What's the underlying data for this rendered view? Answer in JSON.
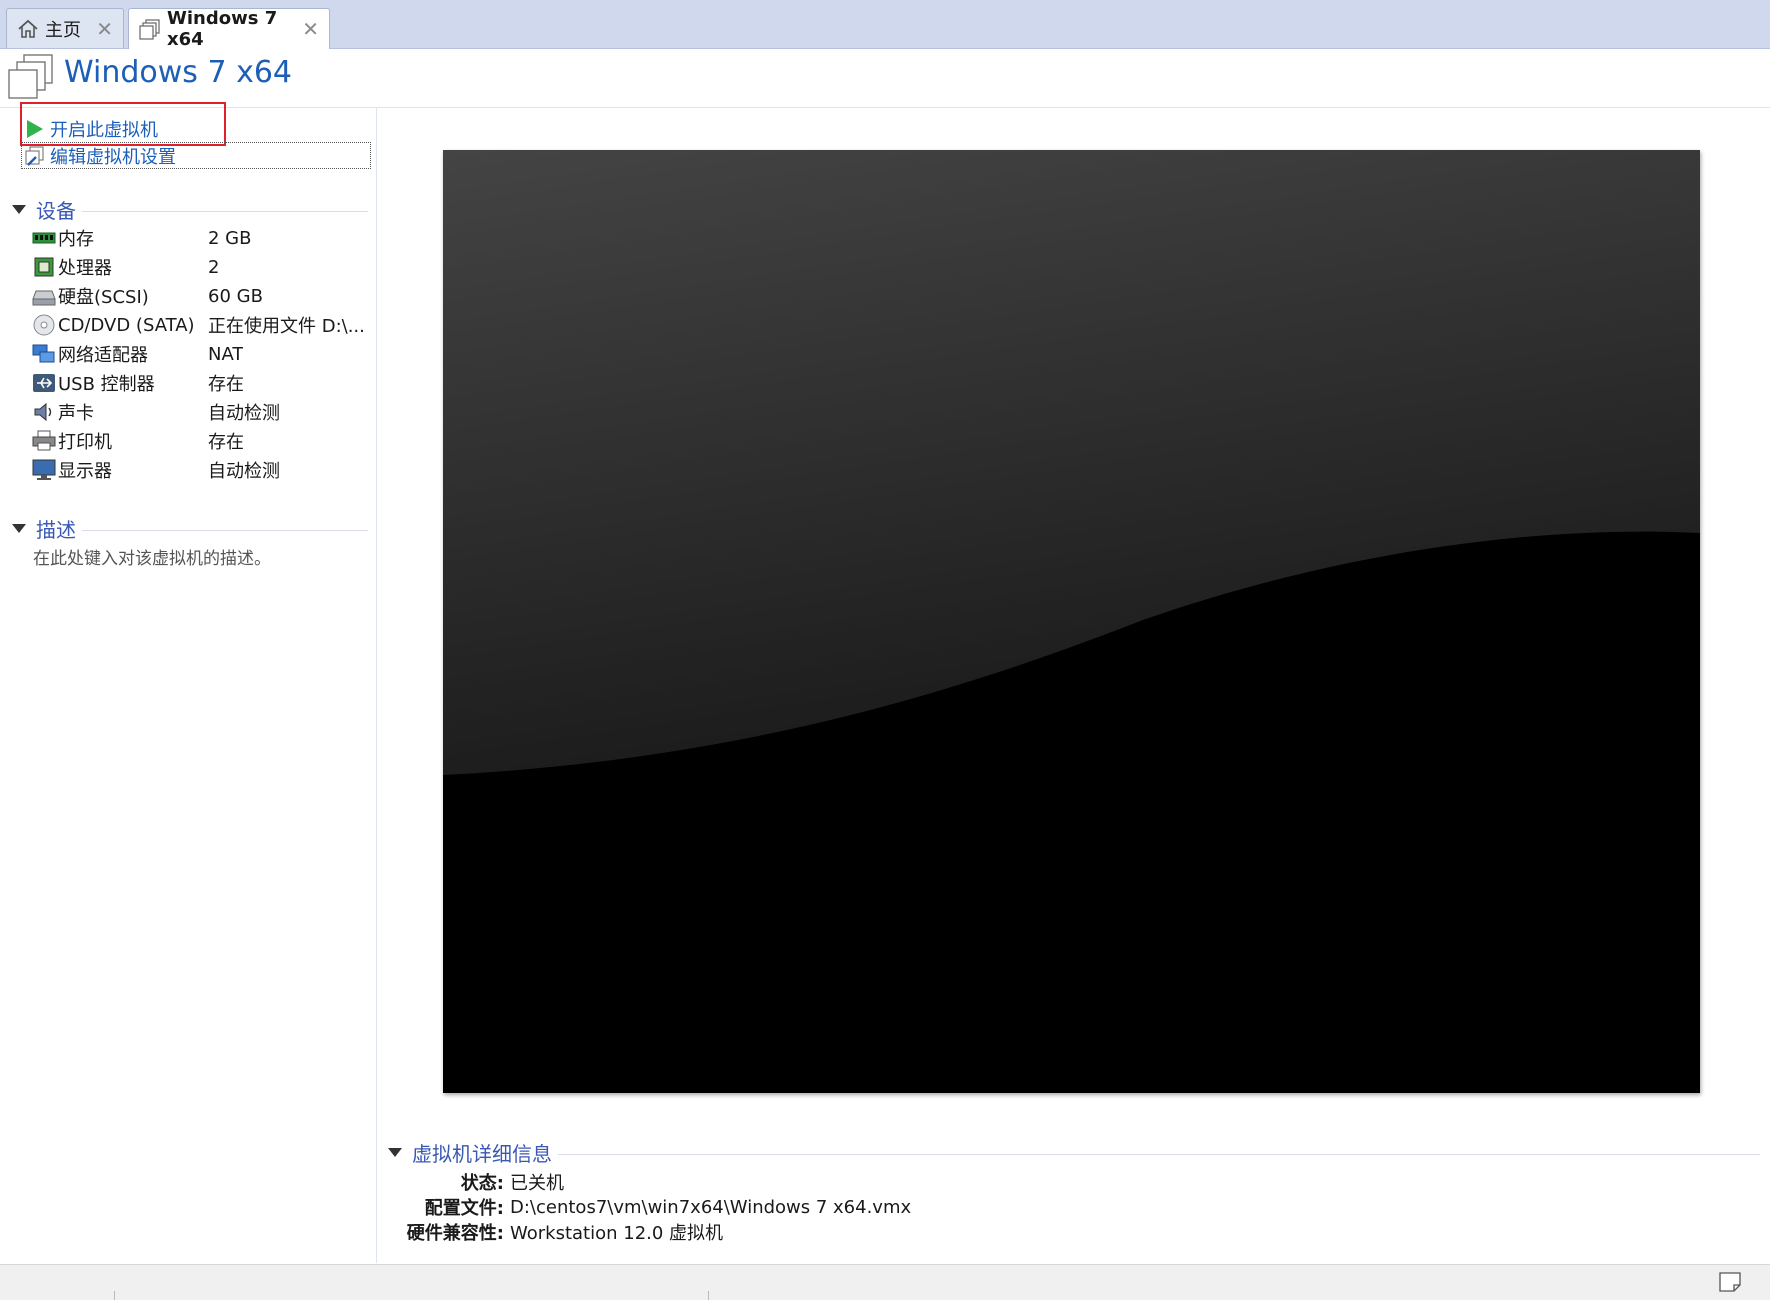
{
  "tabs": [
    {
      "label": "主页",
      "icon": "home-icon",
      "active": false
    },
    {
      "label": "Windows 7 x64",
      "icon": "vm-icon",
      "active": true
    }
  ],
  "header": {
    "title": "Windows 7 x64",
    "title_color": "#1d5fb8"
  },
  "actions": {
    "power_on": "开启此虚拟机",
    "edit_settings": "编辑虚拟机设置"
  },
  "devices_section": {
    "title": "设备"
  },
  "devices": [
    {
      "icon": "memory-icon",
      "name": "内存",
      "value": "2 GB"
    },
    {
      "icon": "processor-icon",
      "name": "处理器",
      "value": "2"
    },
    {
      "icon": "hard-disk-icon",
      "name": "硬盘(SCSI)",
      "value": "60 GB"
    },
    {
      "icon": "cd-dvd-icon",
      "name": "CD/DVD (SATA)",
      "value": "正在使用文件 D:\\..."
    },
    {
      "icon": "network-adapter-icon",
      "name": "网络适配器",
      "value": "NAT"
    },
    {
      "icon": "usb-icon",
      "name": "USB 控制器",
      "value": "存在"
    },
    {
      "icon": "sound-card-icon",
      "name": "声卡",
      "value": "自动检测"
    },
    {
      "icon": "printer-icon",
      "name": "打印机",
      "value": "存在"
    },
    {
      "icon": "display-icon",
      "name": "显示器",
      "value": "自动检测"
    }
  ],
  "description_section": {
    "title": "描述",
    "placeholder": "在此处键入对该虚拟机的描述。"
  },
  "details_section": {
    "title": "虚拟机详细信息",
    "rows": [
      {
        "key": "状态:",
        "value": "已关机"
      },
      {
        "key": "配置文件:",
        "value": "D:\\centos7\\vm\\win7x64\\Windows 7 x64.vmx"
      },
      {
        "key": "硬件兼容性:",
        "value": "Workstation 12.0 虚拟机"
      }
    ]
  },
  "colors": {
    "accent": "#1d5fb8",
    "section_title": "#3a58b5",
    "highlight": "#e0202a",
    "tabbar_bg": "#cfd8ec"
  }
}
